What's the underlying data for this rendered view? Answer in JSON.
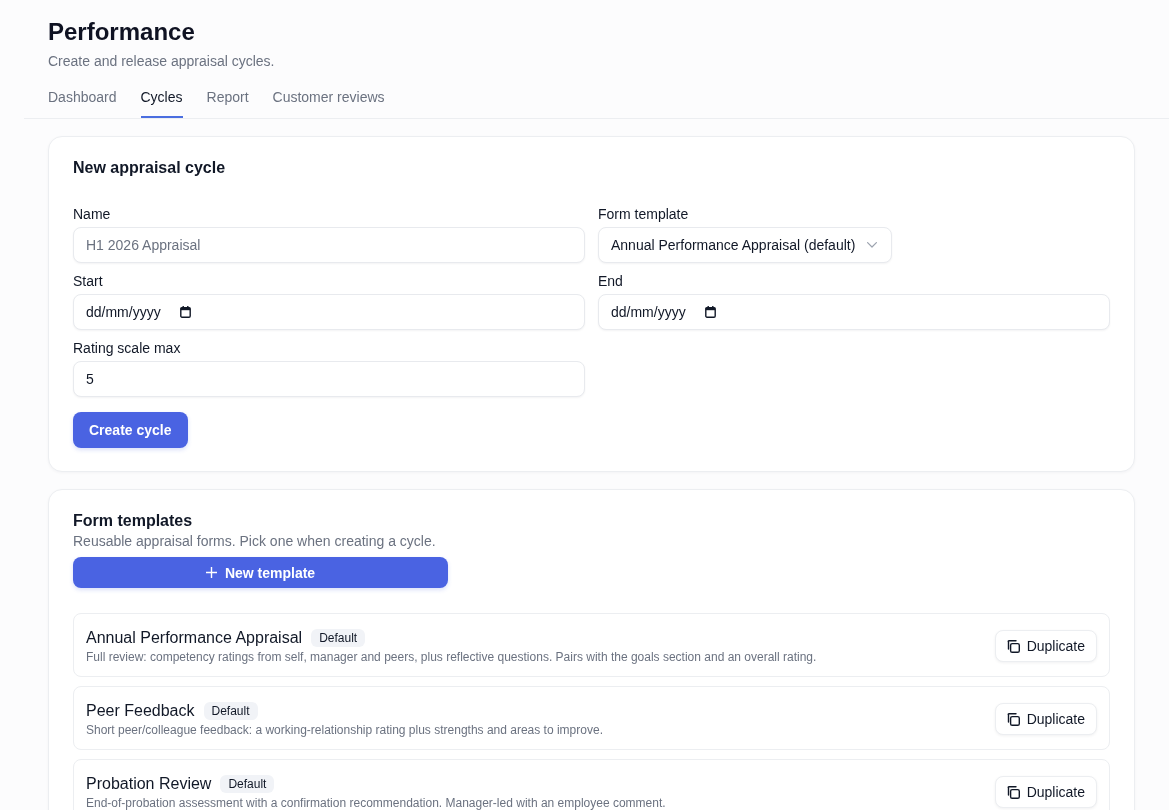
{
  "page": {
    "title": "Performance",
    "subtitle": "Create and release appraisal cycles."
  },
  "tabs": [
    {
      "label": "Dashboard",
      "selected": false
    },
    {
      "label": "Cycles",
      "selected": true
    },
    {
      "label": "Report",
      "selected": false
    },
    {
      "label": "Customer reviews",
      "selected": false
    }
  ],
  "new_cycle_form": {
    "title": "New appraisal cycle",
    "fields": [
      {
        "kind": "text",
        "label": "Name",
        "placeholder": "H1 2026 Appraisal"
      },
      {
        "kind": "select",
        "label": "Form template",
        "value": "Annual Performance Appraisal (default)"
      },
      {
        "kind": "date",
        "label": "Start",
        "format": "dd/mm/yyyy"
      },
      {
        "kind": "date",
        "label": "End",
        "format": "dd/mm/yyyy"
      },
      {
        "kind": "number",
        "label": "Rating scale max",
        "value": "5"
      }
    ],
    "submit_button": "Create cycle"
  },
  "form_templates": {
    "title": "Form templates",
    "subtitle": "Reusable appraisal forms. Pick one when creating a cycle.",
    "new_button": "New template",
    "templates": [
      {
        "name": "Annual Performance Appraisal",
        "badge": "Default",
        "description": "Full review: competency ratings from self, manager and peers, plus reflective questions. Pairs with the goals section and an overall rating.",
        "action": "Duplicate"
      },
      {
        "name": "Peer Feedback",
        "badge": "Default",
        "description": "Short peer/colleague feedback: a working-relationship rating plus strengths and areas to improve.",
        "action": "Duplicate"
      },
      {
        "name": "Probation Review",
        "badge": "Default",
        "description": "End-of-probation assessment with a confirmation recommendation. Manager-led with an employee comment.",
        "action": "Duplicate"
      }
    ]
  }
}
